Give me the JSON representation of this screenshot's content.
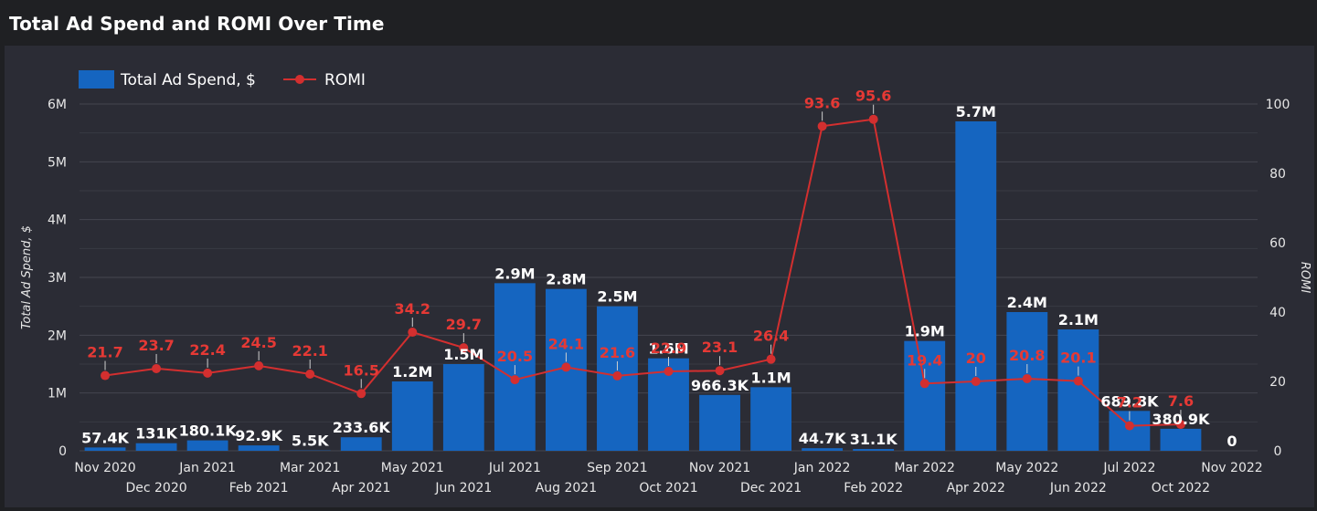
{
  "header": {
    "title": "Total Ad Spend and ROMI Over Time"
  },
  "chart_data": {
    "type": "bar",
    "title": "Total Ad Spend and ROMI Over Time",
    "categories": [
      "Nov 2020",
      "Dec 2020",
      "Jan 2021",
      "Feb 2021",
      "Mar 2021",
      "Apr 2021",
      "May 2021",
      "Jun 2021",
      "Jul 2021",
      "Aug 2021",
      "Sep 2021",
      "Oct 2021",
      "Nov 2021",
      "Dec 2021",
      "Jan 2022",
      "Feb 2022",
      "Mar 2022",
      "Apr 2022",
      "May 2022",
      "Jun 2022",
      "Jul 2022",
      "Oct 2022",
      "Nov 2022"
    ],
    "series": [
      {
        "name": "Total Ad Spend, $",
        "type": "bar",
        "axis": "left",
        "color": "#1565c0",
        "values": [
          57400,
          131000,
          180100,
          92900,
          5500,
          233600,
          1200000,
          1500000,
          2900000,
          2800000,
          2500000,
          1600000,
          966300,
          1100000,
          44700,
          31100,
          1900000,
          5700000,
          2400000,
          2100000,
          689800,
          380900,
          0
        ],
        "labels": [
          "57.4K",
          "131K",
          "180.1K",
          "92.9K",
          "5.5K",
          "233.6K",
          "1.2M",
          "1.5M",
          "2.9M",
          "2.8M",
          "2.5M",
          "1.6M",
          "966.3K",
          "1.1M",
          "44.7K",
          "31.1K",
          "1.9M",
          "5.7M",
          "2.4M",
          "2.1M",
          "689.8K",
          "380.9K",
          "0"
        ]
      },
      {
        "name": "ROMI",
        "type": "line",
        "axis": "right",
        "color": "#d32f2f",
        "values": [
          21.7,
          23.7,
          22.4,
          24.5,
          22.1,
          16.5,
          34.2,
          29.7,
          20.5,
          24.1,
          21.6,
          22.9,
          23.1,
          26.4,
          93.6,
          95.6,
          19.4,
          20,
          20.8,
          20.1,
          7.2,
          7.6,
          null
        ],
        "labels": [
          "21.7",
          "23.7",
          "22.4",
          "24.5",
          "22.1",
          "16.5",
          "34.2",
          "29.7",
          "20.5",
          "24.1",
          "21.6",
          "22.9",
          "23.1",
          "26.4",
          "93.6",
          "95.6",
          "19.4",
          "20",
          "20.8",
          "20.1",
          "7.2",
          "7.6",
          ""
        ]
      }
    ],
    "ylabel": "Total Ad Spend, $",
    "y2label": "ROMI",
    "ylim": [
      0,
      6000000
    ],
    "y2lim": [
      0,
      100
    ],
    "yticks": [
      "0",
      "1M",
      "2M",
      "3M",
      "4M",
      "5M",
      "6M"
    ],
    "y2ticks": [
      "0",
      "20",
      "40",
      "60",
      "80",
      "100"
    ],
    "grid": true,
    "legend": "top-left"
  }
}
